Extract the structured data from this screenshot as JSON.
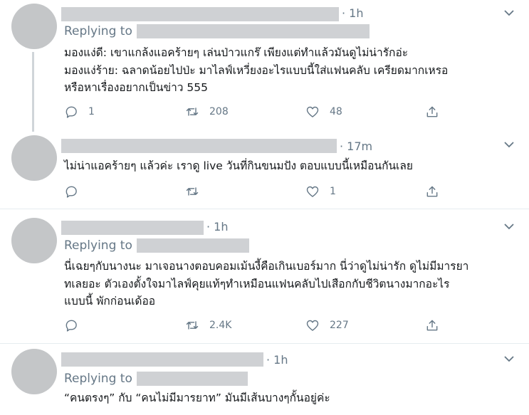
{
  "tweets": [
    {
      "time": "· 1h",
      "replying_label": "Replying to",
      "lines": [
        "มองแง่ดี: เขาแกล้งแอคร้ายๆ เล่นป่าวแกร๊ เพียงแต่ทำแล้วมันดูไม่น่ารักอ่ะ",
        "มองแง่ร้าย: ฉลาดน้อยไปป่ะ มาไลฟ์เหวี่ยงอะไรแบบนี้ใส่แฟนคลับ เครียดมากเหรอ",
        "หรือหาเรื่องอยากเป็นข่าว 555"
      ],
      "replies": "1",
      "retweets": "208",
      "likes": "48"
    },
    {
      "time": "· 17m",
      "lines": [
        "ไม่น่าแอคร้ายๆ แล้วค่ะ เราดู live วันที่กินขนมปัง ตอบแบบนี้เหมือนกันเลย"
      ],
      "replies": "",
      "retweets": "",
      "likes": "1"
    },
    {
      "time": "· 1h",
      "replying_label": "Replying to",
      "lines": [
        "นี่เฉยๆกับนางนะ มาเจอนางตอบคอมเม้นงี้คือเกินเบอร์มาก นี่ว่าดูไม่น่ารัก ดูไม่มีมารยา",
        "ทเลยอะ ตัวเองตั้งใจมาไลฟ์คุยแท้ๆทำเหมือนแฟนคลับไปเสือกกับชีวิตนางมากอะไร",
        "แบบนี้ พักก่อนเด้ออ"
      ],
      "replies": "",
      "retweets": "2.4K",
      "likes": "227"
    },
    {
      "time": "· 1h",
      "replying_label": "Replying to",
      "lines": [
        "“คนตรงๆ” กับ “คนไม่มีมารยาท” มันมีเส้นบางๆกั้นอยู่ค่ะ"
      ]
    }
  ]
}
